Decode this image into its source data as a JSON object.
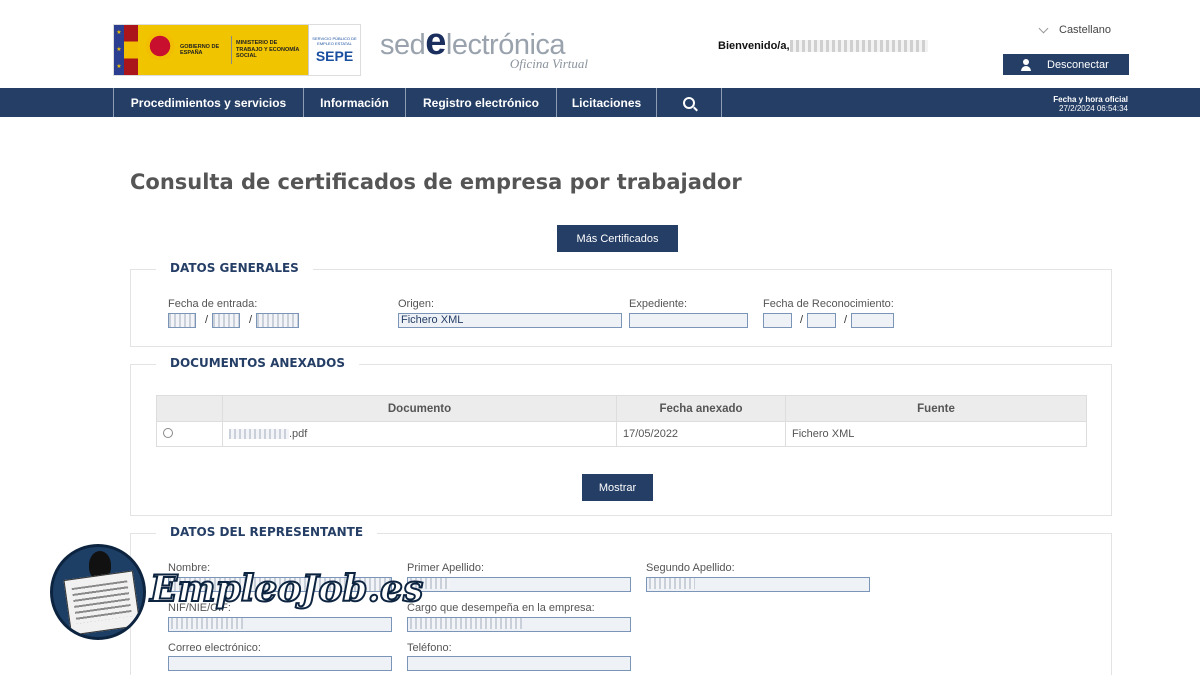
{
  "header": {
    "gov_text": "GOBIERNO DE ESPAÑA",
    "ministry_text": "MINISTERIO DE TRABAJO Y ECONOMÍA SOCIAL",
    "sepe_small": "SERVICIO PÚBLICO DE EMPLEO ESTATAL",
    "sepe_big": "SEPE",
    "sede_pre": "sed",
    "sede_e": "e",
    "sede_post": "lectrónica",
    "sede_sub": "Oficina Virtual",
    "welcome": "Bienvenido/a,",
    "language": "Castellano",
    "disconnect": "Desconectar"
  },
  "nav": {
    "items": [
      {
        "label": "Procedimientos y servicios"
      },
      {
        "label": "Información"
      },
      {
        "label": "Registro electrónico"
      },
      {
        "label": "Licitaciones"
      }
    ],
    "datetime_label": "Fecha y hora oficial",
    "datetime_value": "27/2/2024 06:54:34"
  },
  "page": {
    "title": "Consulta de certificados de empresa por trabajador",
    "mas_certificados": "Más Certificados"
  },
  "datos_generales": {
    "title": "DATOS GENERALES",
    "fecha_entrada_label": "Fecha de entrada:",
    "origen_label": "Origen:",
    "origen_value": "Fichero XML",
    "expediente_label": "Expediente:",
    "fecha_reconocimiento_label": "Fecha de Reconocimiento:",
    "slash": "/"
  },
  "documentos": {
    "title": "DOCUMENTOS ANEXADOS",
    "columns": [
      "",
      "Documento",
      "Fecha anexado",
      "Fuente"
    ],
    "rows": [
      {
        "documento": ".pdf",
        "fecha": "17/05/2022",
        "fuente": "Fichero XML"
      }
    ],
    "mostrar": "Mostrar"
  },
  "representante": {
    "title": "DATOS DEL REPRESENTANTE",
    "nombre_label": "Nombre:",
    "primer_apellido_label": "Primer Apellido:",
    "segundo_apellido_label": "Segundo Apellido:",
    "nif_label": "NIF/NIE/CIF:",
    "cargo_label": "Cargo que desempeña en la empresa:",
    "correo_label": "Correo electrónico:",
    "telefono_label": "Teléfono:"
  },
  "watermark": {
    "text": "EmpleoJob.es"
  }
}
